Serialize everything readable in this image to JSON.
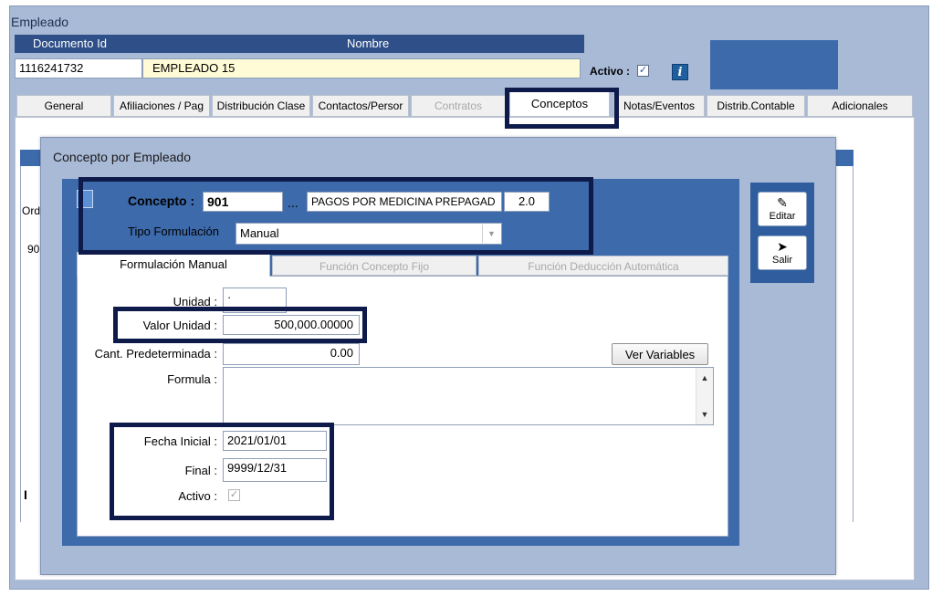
{
  "window": {
    "title": "Empleado"
  },
  "header": {
    "documento_label": "Documento Id",
    "nombre_label": "Nombre",
    "documento_value": "1116241732",
    "nombre_value": "EMPLEADO 15",
    "activo_label": "Activo :",
    "activo_checked": "✓",
    "info_icon": "i"
  },
  "tabs": [
    {
      "label": "General"
    },
    {
      "label": "Afiliaciones / Pag"
    },
    {
      "label": "Distribución Clase"
    },
    {
      "label": "Contactos/Persor"
    },
    {
      "label": "Contratos"
    },
    {
      "label": "Conceptos"
    },
    {
      "label": "Notas/Eventos"
    },
    {
      "label": "Distrib.Contable"
    },
    {
      "label": "Adicionales"
    }
  ],
  "background": {
    "col_label": "Ord",
    "row_value": "90",
    "mark": "I"
  },
  "modal": {
    "title": "Concepto por Empleado",
    "concepto_label": "Concepto :",
    "concepto_code": "901",
    "ellipsis": "...",
    "concepto_desc": "PAGOS POR MEDICINA PREPAGAD",
    "concepto_val": "2.0",
    "tipo_label": "Tipo Formulación",
    "tipo_value": "Manual",
    "inner_tabs": [
      {
        "label": "Formulación Manual"
      },
      {
        "label": "Función Concepto Fijo"
      },
      {
        "label": "Función Deducción Automática"
      }
    ],
    "unidad_label": "Unidad :",
    "unidad_value": "·",
    "valor_label": "Valor Unidad :",
    "valor_value": "500,000.00000",
    "cant_label": "Cant. Predeterminada :",
    "cant_value": "0.00",
    "ver_variables": "Ver Variables",
    "formula_label": "Formula :",
    "formula_value": "",
    "fecha_inicial_label": "Fecha Inicial :",
    "fecha_inicial_value": "2021/01/01",
    "final_label": "Final :",
    "final_value": "9999/12/31",
    "activo_label": "Activo :",
    "activo_checked": "✓",
    "editar_label": "Editar",
    "salir_label": "Salir"
  },
  "colors": {
    "accent": "#3c6aab",
    "header_bar": "#2e4f88",
    "window_bg": "#a9bad7",
    "highlight": "#0e1a4a",
    "name_field": "#fffbd6"
  }
}
